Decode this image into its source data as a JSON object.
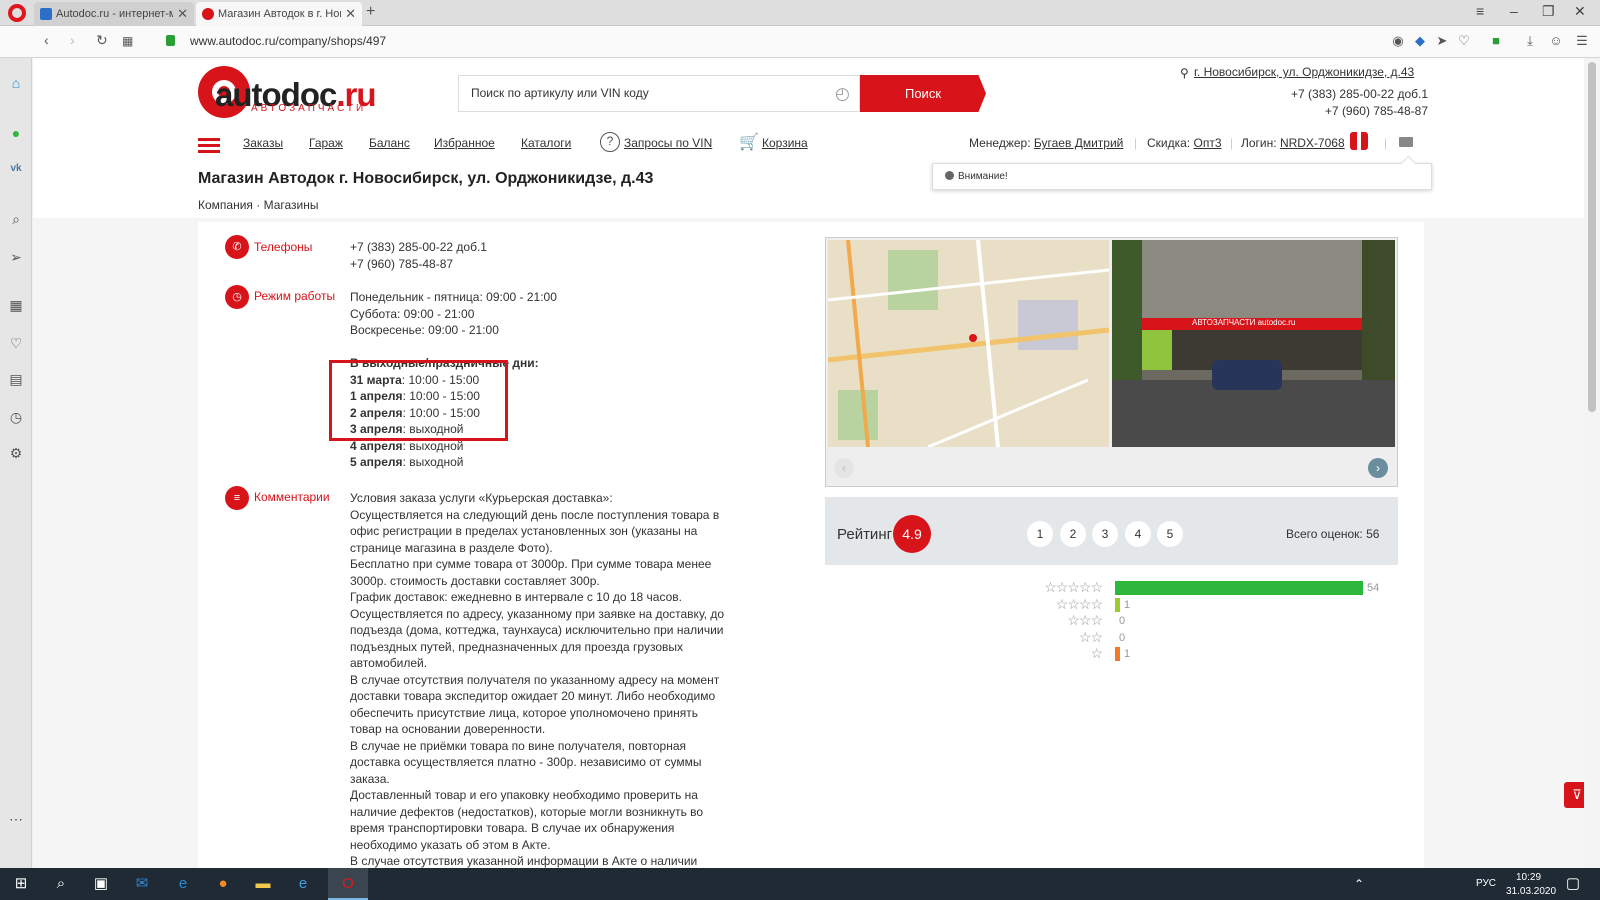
{
  "browser": {
    "tabs": [
      {
        "title": "Autodoc.ru - интернет-ма"
      },
      {
        "title": "Магазин Автодок в г. Нов"
      }
    ],
    "url": "www.autodoc.ru/company/shops/497"
  },
  "header": {
    "logo_main": "autodoc",
    "logo_tld": ".ru",
    "logo_sub": "АВТОЗАПЧАСТИ",
    "search_placeholder": "Поиск по артикулу или VIN коду",
    "search_button": "Поиск",
    "city_address": "г. Новосибирск, ул. Орджоникидзе, д.43",
    "phone1": "+7 (383) 285-00-22 доб.1",
    "phone2": "+7 (960) 785-48-87"
  },
  "nav": {
    "items": [
      "Заказы",
      "Гараж",
      "Баланс",
      "Избранное",
      "Каталоги"
    ],
    "vin_requests": "Запросы по VIN",
    "cart": "Корзина",
    "manager_label": "Менеджер:",
    "manager_name": "Бугаев Дмитрий",
    "discount_label": "Скидка:",
    "discount_value": "Опт3",
    "login_label": "Логин:",
    "login_value": "NRDX-7068"
  },
  "attention": "Внимание!",
  "page_title": "Магазин Автодок г. Новосибирск, ул. Орджоникидзе, д.43",
  "breadcrumb": "Компания · Магазины",
  "phones": {
    "label": "Телефоны",
    "lines": [
      "+7 (383) 285-00-22 доб.1",
      "+7 (960) 785-48-87"
    ]
  },
  "schedule": {
    "label": "Режим работы",
    "lines": [
      "Понедельник - пятница: 09:00 - 21:00",
      "Суббота: 09:00 - 21:00",
      "Воскресенье: 09:00 - 21:00"
    ],
    "holiday_title": "В выходные/праздничные дни:",
    "holidays": [
      {
        "date": "31 марта",
        "hours": ": 10:00 - 15:00"
      },
      {
        "date": "1 апреля",
        "hours": ": 10:00 - 15:00"
      },
      {
        "date": "2 апреля",
        "hours": ": 10:00 - 15:00"
      },
      {
        "date": "3 апреля",
        "hours": ": выходной"
      },
      {
        "date": "4 апреля",
        "hours": ": выходной"
      },
      {
        "date": "5 апреля",
        "hours": ": выходной"
      }
    ]
  },
  "comments": {
    "label": "Комментарии",
    "lines": [
      "Условия заказа услуги «Курьерская доставка»:",
      "Осуществляется на следующий день после поступления товара в",
      "офис регистрации в пределах установленных зон (указаны на",
      "странице магазина в разделе Фото).",
      "Бесплатно при сумме товара от 3000р. При сумме товара менее",
      "3000р. стоимость доставки составляет 300р.",
      "График доставок: ежедневно в интервале с 10 до 18 часов.",
      "Осуществляется по адресу, указанному при заявке на доставку, до",
      "подъезда (дома, коттеджа, таунхауса) исключительно при наличии",
      "подъездных путей, предназначенных для проезда грузовых",
      "автомобилей.",
      "В случае отсутствия получателя по указанному адресу на момент",
      "доставки товара экспедитор ожидает 20 минут. Либо необходимо",
      "обеспечить присутствие лица, которое уполномочено принять",
      "товар на основании доверенности.",
      "В случае не приёмки товара по вине получателя, повторная",
      "доставка осуществляется платно - 300р. независимо от суммы",
      "заказа.",
      "Доставленный товар и его упаковку необходимо проверить на",
      "наличие дефектов (недостатков), которые могли возникнуть во",
      "время транспортировки товара. В случае их обнаружения",
      "необходимо указать об этом в Акте.",
      "В случае отсутствия указанной информации в Акте о наличии"
    ]
  },
  "photo_sign": "АВТОЗАПЧАСТИ autodoc.ru",
  "rating": {
    "label": "Рейтинг",
    "value": "4.9",
    "pages": [
      "1",
      "2",
      "3",
      "4",
      "5"
    ],
    "total_label": "Всего оценок: 56",
    "breakdown": [
      {
        "stars": 5,
        "count": 54,
        "color": "#2db83d"
      },
      {
        "stars": 4,
        "count": 1,
        "color": "#9ccc2e"
      },
      {
        "stars": 3,
        "count": 0,
        "color": "#cccccc"
      },
      {
        "stars": 2,
        "count": 0,
        "color": "#cccccc"
      },
      {
        "stars": 1,
        "count": 1,
        "color": "#f07a2a"
      }
    ]
  },
  "taskbar": {
    "lang": "РУС",
    "time": "10:29",
    "date": "31.03.2020"
  },
  "colors": {
    "brand": "#d7141a"
  }
}
